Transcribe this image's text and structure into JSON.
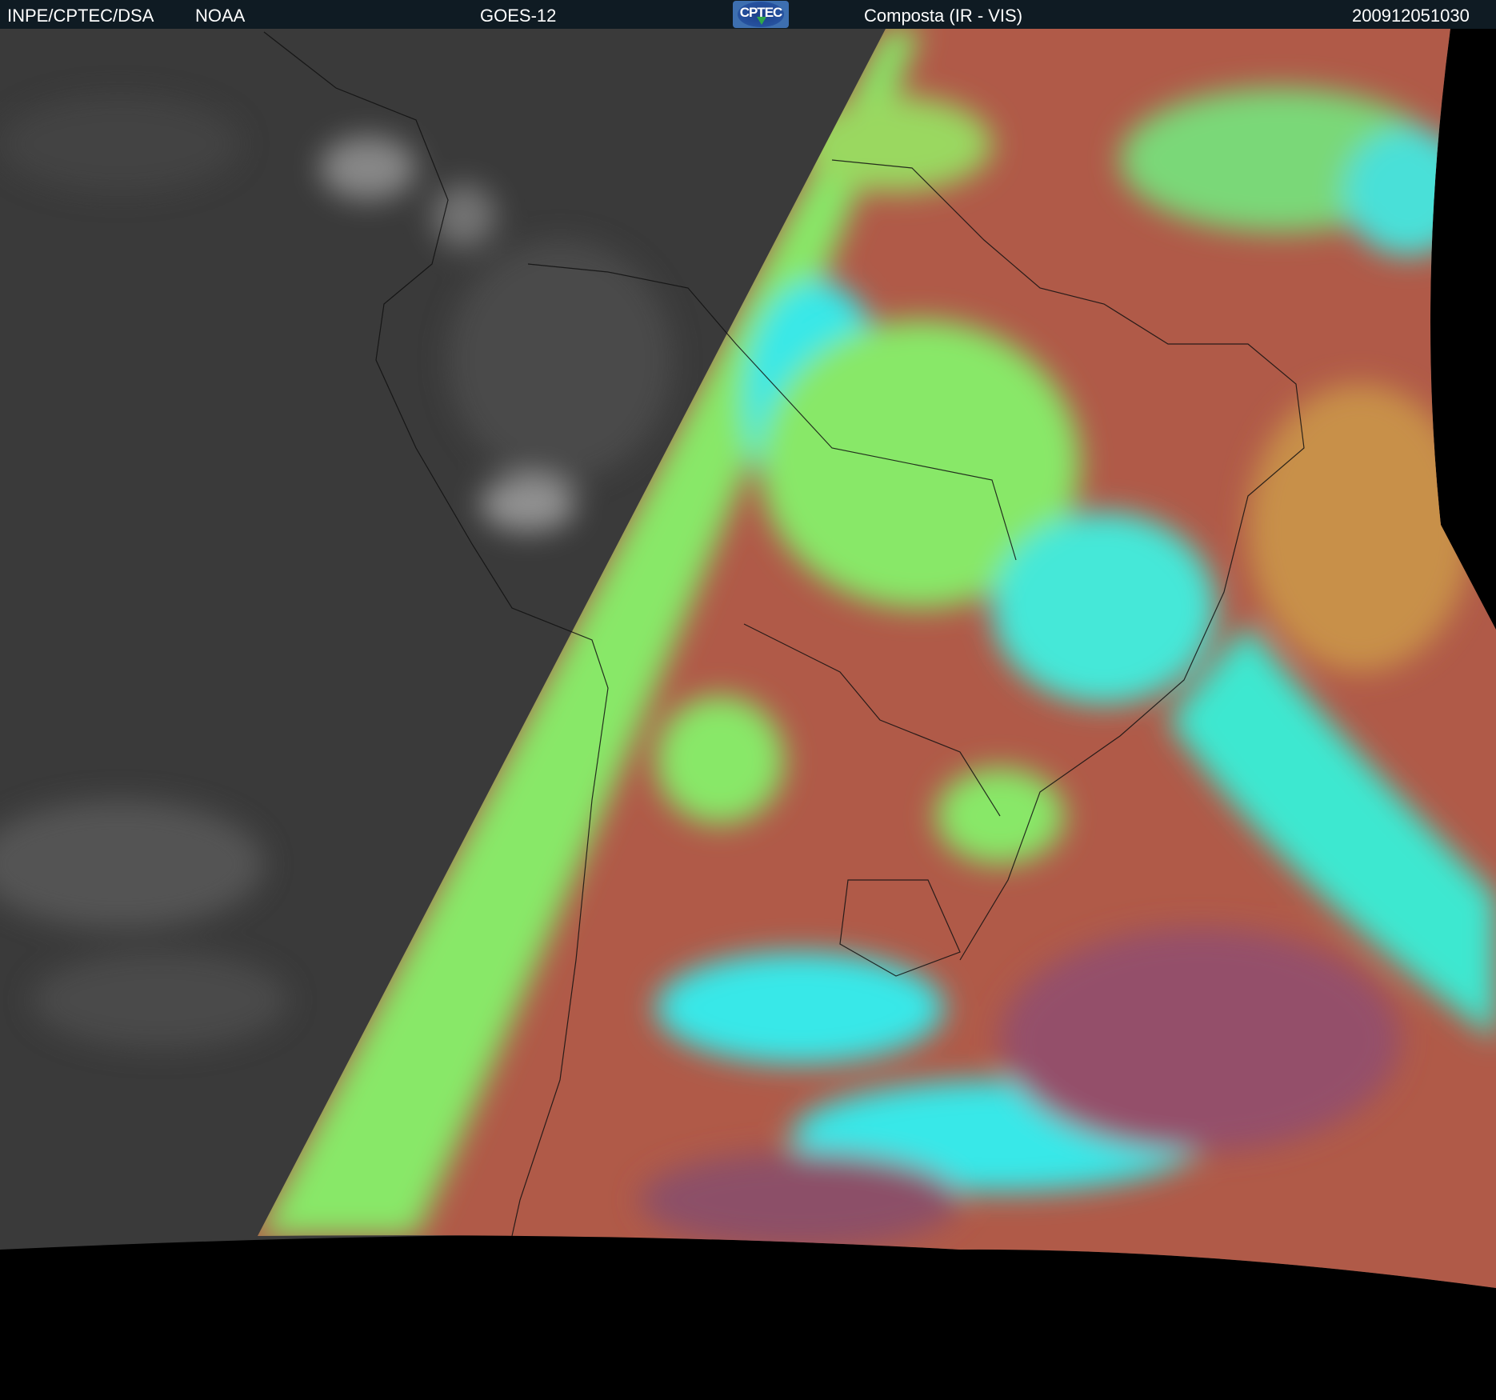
{
  "header": {
    "institution": "INPE/CPTEC/DSA",
    "agency": "NOAA",
    "satellite": "GOES-12",
    "logo_text": "CPTEC",
    "product": "Composta (IR - VIS)",
    "timestamp": "200912051030"
  },
  "colors": {
    "header_bg": "#0f1b23",
    "night_gray": "#3a3a3a",
    "cloud_green": "#88e868",
    "cloud_cyan": "#38e8e8",
    "surface_red": "#b05a48",
    "ocean_purple": "#8c5068"
  }
}
